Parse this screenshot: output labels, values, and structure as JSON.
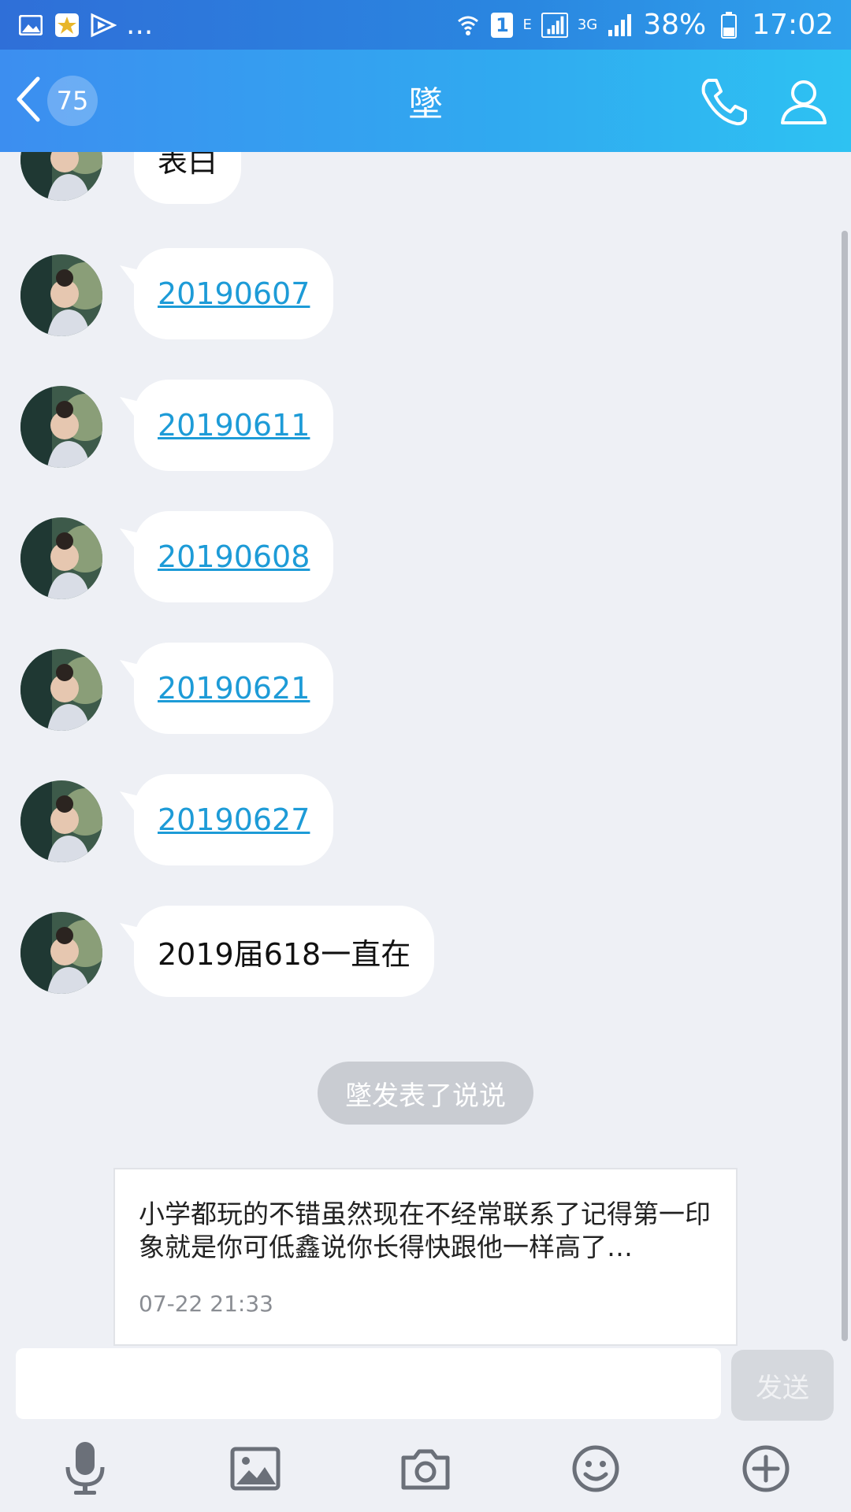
{
  "status_bar": {
    "left_icons": [
      "image-icon",
      "star-app-icon",
      "video-play-icon"
    ],
    "overflow": "...",
    "sim_badge": "1",
    "network_e": "E",
    "network_3g": "3G",
    "battery": "38%",
    "time": "17:02"
  },
  "header": {
    "back_count": "75",
    "title": "墜",
    "call_icon": "phone-icon",
    "profile_icon": "user-icon"
  },
  "messages": [
    {
      "text": "表白",
      "type": "text"
    },
    {
      "text": "20190607",
      "type": "link"
    },
    {
      "text": "20190611",
      "type": "link"
    },
    {
      "text": "20190608",
      "type": "link"
    },
    {
      "text": "20190621",
      "type": "link"
    },
    {
      "text": "20190627",
      "type": "link"
    },
    {
      "text": "2019届618一直在",
      "type": "text"
    }
  ],
  "system_notice": "墜发表了说说",
  "feed_card": {
    "text": "小学都玩的不错虽然现在不经常联系了记得第一印象就是你可低鑫说你长得快跟他一样高了…",
    "time": "07-22 21:33"
  },
  "input": {
    "placeholder": "",
    "send_label": "发送"
  },
  "toolbar": [
    "microphone-icon",
    "image-icon",
    "camera-icon",
    "emoji-icon",
    "plus-icon"
  ]
}
